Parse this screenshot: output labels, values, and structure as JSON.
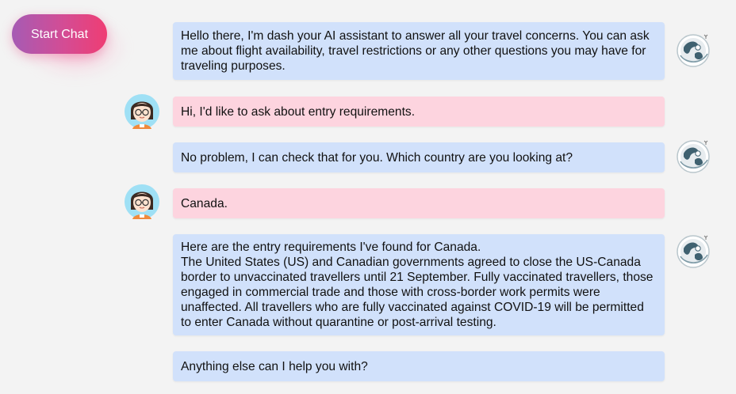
{
  "start_button": {
    "label": "Start Chat"
  },
  "messages": [
    {
      "sender": "bot",
      "text": "Hello there, I'm dash your AI assistant to answer all your travel concerns. You can ask me about flight availability, travel restrictions or any other questions you may have for traveling purposes."
    },
    {
      "sender": "user",
      "text": "Hi, I'd like to ask about entry requirements."
    },
    {
      "sender": "bot",
      "text": "No problem, I can check that for you. Which country are you looking at?"
    },
    {
      "sender": "user",
      "text": "Canada."
    },
    {
      "sender": "bot",
      "text": "Here are the entry requirements I've found for Canada.\nThe United States (US) and Canadian governments agreed to close the US-Canada border to unvaccinated travellers until 21 September. Fully vaccinated travellers, those engaged in commercial trade and those with cross-border work permits were unaffected. All travellers who are fully vaccinated against COVID-19 will be permitted to enter Canada without quarantine or post-arrival testing."
    },
    {
      "sender": "bot",
      "text": "Anything else can I help you with?"
    }
  ],
  "icons": {
    "bot_avatar": "globe-astronaut-icon",
    "user_avatar": "girl-with-glasses-icon"
  },
  "colors": {
    "bot_bubble": "#d1e1fb",
    "user_bubble": "#fdd4df",
    "button_gradient_start": "#a65bb4",
    "button_gradient_end": "#ef3d73",
    "background": "#f3f3f3"
  }
}
